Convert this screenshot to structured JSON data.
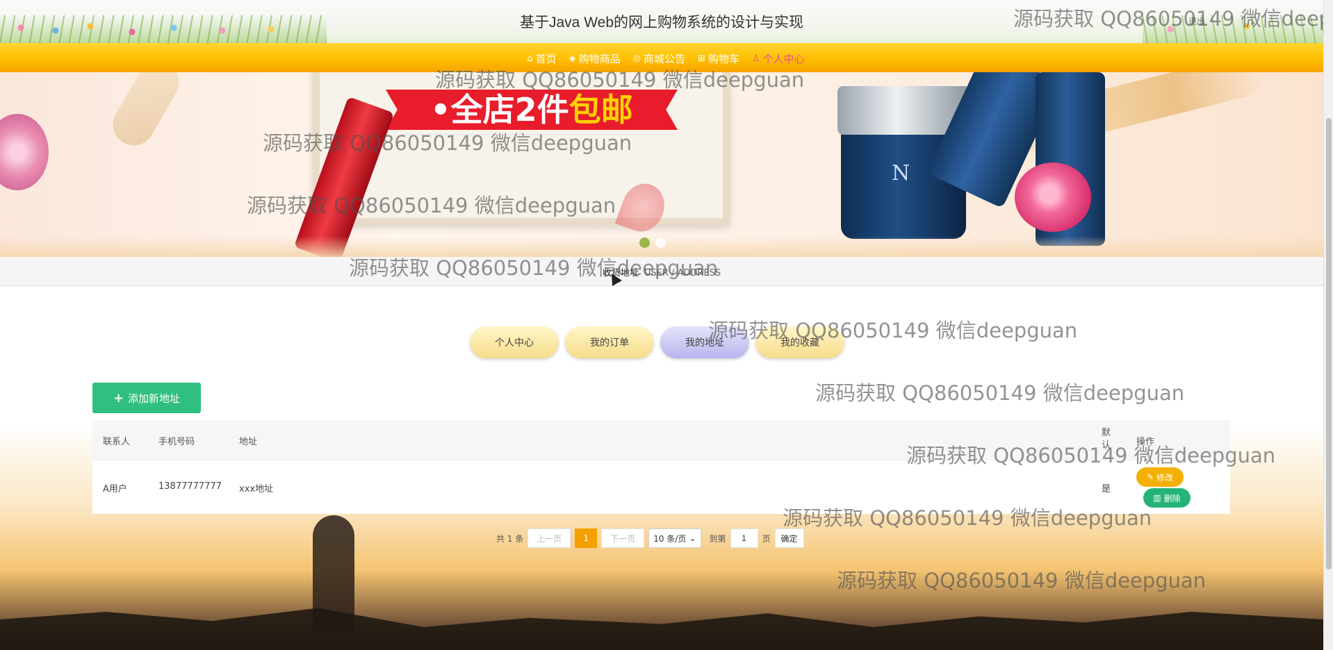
{
  "header": {
    "title": "基于Java Web的网上购物系统的设计与实现",
    "logout_label": "退出"
  },
  "nav": {
    "items": [
      {
        "label": "首页",
        "icon": "home-icon"
      },
      {
        "label": "购物商品",
        "icon": "box-icon"
      },
      {
        "label": "商城公告",
        "icon": "announcement-icon"
      },
      {
        "label": "购物车",
        "icon": "cart-icon"
      },
      {
        "label": "个人中心",
        "icon": "user-icon",
        "active": true
      }
    ],
    "active_color": "#e84a9c",
    "bar_color": "#ffbf00"
  },
  "banner": {
    "promo_text_a": "•全店2件",
    "promo_text_b": "包邮",
    "jar_mark": "N",
    "carousel_active_index": 0
  },
  "breadcrumb": {
    "cn": "收货地址",
    "en": "USER / ADDRESS"
  },
  "tabs": [
    {
      "label": "个人中心",
      "active": false
    },
    {
      "label": "我的订单",
      "active": false
    },
    {
      "label": "我的地址",
      "active": true
    },
    {
      "label": "我的收藏",
      "active": false
    }
  ],
  "add_button": {
    "label": "添加新地址",
    "color": "#2fbf7e"
  },
  "table": {
    "headers": [
      "联系人",
      "手机号码",
      "地址",
      "默认",
      "操作"
    ],
    "rows": [
      {
        "contact": "A用户",
        "phone": "13877777777",
        "address": "xxx地址",
        "default": "是",
        "edit": "修改",
        "delete": "删除"
      }
    ]
  },
  "pager": {
    "total": "共 1 条",
    "prev": "上一页",
    "current": "1",
    "next": "下一页",
    "page_size": "10 条/页",
    "goto": "到第",
    "goto_value": "1",
    "page_unit": "页",
    "confirm": "确定"
  },
  "watermark": "源码获取 QQ86050149 微信deepguan",
  "watermark_top_right": "源码获取 QQ86050149 微信deep"
}
